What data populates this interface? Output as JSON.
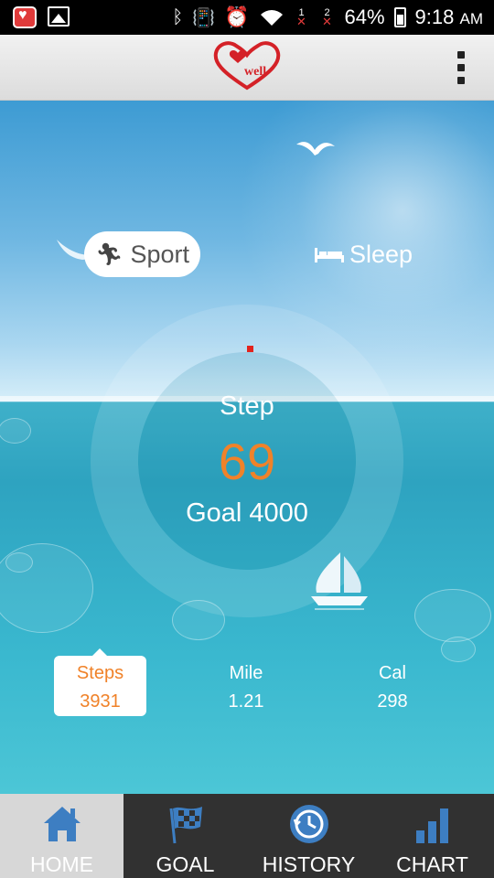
{
  "status_bar": {
    "battery": "64%",
    "time": "9:18",
    "ampm": "AM",
    "sim1": "1",
    "sim2": "2"
  },
  "app_bar": {
    "logo_text": "well",
    "logo_icon": "heart-logo-icon",
    "menu_icon": "overflow-menu-icon"
  },
  "mode_tabs": [
    {
      "label": "Sport",
      "icon": "running-icon",
      "selected": true
    },
    {
      "label": "Sleep",
      "icon": "bed-icon",
      "selected": false
    }
  ],
  "progress": {
    "label": "Step",
    "value": "69",
    "goal": "Goal 4000",
    "accent_color": "#f08229",
    "indicator_color": "#e3231d"
  },
  "stats": [
    {
      "label": "Steps",
      "value": "3931",
      "selected": true
    },
    {
      "label": "Mile",
      "value": "1.21",
      "selected": false
    },
    {
      "label": "Cal",
      "value": "298",
      "selected": false
    }
  ],
  "nav": [
    {
      "label": "HOME",
      "icon": "home-icon",
      "active": true
    },
    {
      "label": "GOAL",
      "icon": "checkered-flag-icon",
      "active": false
    },
    {
      "label": "HISTORY",
      "icon": "history-clock-icon",
      "active": false
    },
    {
      "label": "CHART",
      "icon": "bar-chart-icon",
      "active": false
    }
  ],
  "colors": {
    "orange": "#f08229",
    "nav_blue": "#3d7ec2",
    "sea": "#2ea3c0"
  }
}
